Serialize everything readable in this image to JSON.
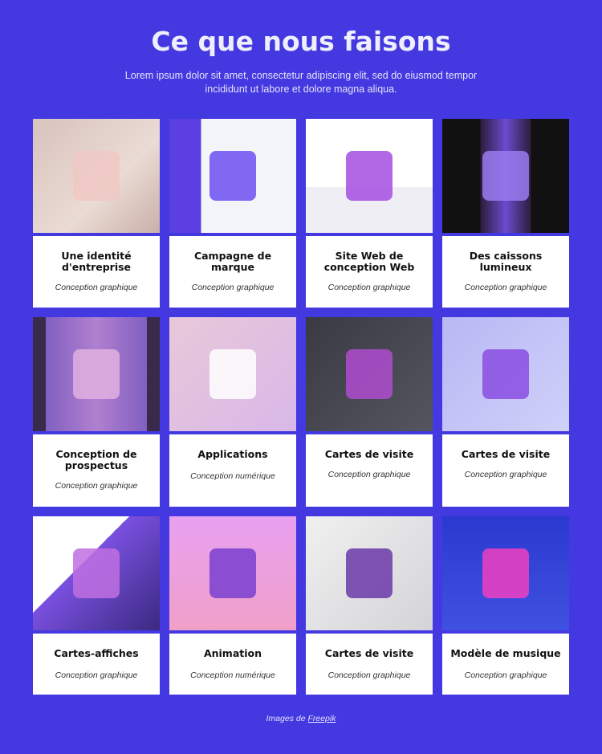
{
  "header": {
    "title": "Ce que nous faisons",
    "subtitle": "Lorem ipsum dolor sit amet, consectetur adipiscing elit, sed do eiusmod tempor incididunt ut labore et dolore magna aliqua."
  },
  "items": [
    {
      "title": "Une identité d'entreprise",
      "category": "Conception graphique",
      "bg": "linear-gradient(135deg,#d8c3bd,#eadbd4 60%,#c9b0a8)",
      "accent": "#f0c8c4"
    },
    {
      "title": "Campagne de marque",
      "category": "Conception graphique",
      "bg": "linear-gradient(90deg,#5b3fe0 25%,#f4f4fb 25%)",
      "accent": "#6b4ff0"
    },
    {
      "title": "Site Web de conception Web",
      "category": "Conception graphique",
      "bg": "linear-gradient(180deg,#ffffff 60%,#eeeef4 60%)",
      "accent": "#a44ce0"
    },
    {
      "title": "Des caissons lumineux",
      "category": "Conception graphique",
      "bg": "linear-gradient(90deg,#111 30%,#2a1d3a 30%,#6c4bd0 50%,#2a1d3a 70%,#111 70%)",
      "accent": "#9a7bf0"
    },
    {
      "title": "Conception de prospectus",
      "category": "Conception graphique",
      "bg": "linear-gradient(90deg,#3a2a4a 10%,#8060c0 10%,#b080d0 50%,#8060c0 90%,#3a2a4a 90%)",
      "accent": "#e0b0e0"
    },
    {
      "title": "Applications",
      "category": "Conception numérique",
      "bg": "linear-gradient(135deg,#e8c8d8,#d8b8e8)",
      "accent": "#ffffff"
    },
    {
      "title": "Cartes de visite",
      "category": "Conception graphique",
      "bg": "linear-gradient(135deg,#3a3a44,#55555f)",
      "accent": "#b04cd0"
    },
    {
      "title": "Cartes de visite",
      "category": "Conception graphique",
      "bg": "linear-gradient(135deg,#b8b8f4,#d0d0fa)",
      "accent": "#8a4ce0"
    },
    {
      "title": "Cartes-affiches",
      "category": "Conception graphique",
      "bg": "linear-gradient(135deg,#ffffff 40%,#7a50e0 40%,#3a2a80)",
      "accent": "#c070e0"
    },
    {
      "title": "Animation",
      "category": "Conception numérique",
      "bg": "linear-gradient(180deg,#e8a0f0,#f0a0c8)",
      "accent": "#7a40d0"
    },
    {
      "title": "Cartes de visite",
      "category": "Conception graphique",
      "bg": "linear-gradient(135deg,#f0f0f0,#d4d4d8)",
      "accent": "#6a3aa8"
    },
    {
      "title": "Modèle de musique",
      "category": "Conception graphique",
      "bg": "linear-gradient(180deg,#2a3ad0,#4050e0)",
      "accent": "#f040c0"
    }
  ],
  "footer": {
    "prefix": "Images de",
    "link": "Freepik"
  }
}
